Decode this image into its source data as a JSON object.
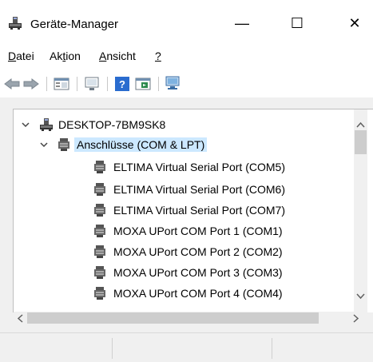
{
  "window": {
    "title": "Geräte-Manager",
    "controls": {
      "minimize": "—",
      "maximize": "☐",
      "close": "✕"
    }
  },
  "menu": [
    {
      "pre": "",
      "u": "D",
      "post": "atei"
    },
    {
      "pre": "Ak",
      "u": "t",
      "post": "ion"
    },
    {
      "pre": "",
      "u": "A",
      "post": "nsicht"
    },
    {
      "pre": "",
      "u": "?",
      "post": ""
    }
  ],
  "toolbar": {
    "icons": [
      "back-icon",
      "forward-icon",
      "properties-icon",
      "monitor-icon",
      "help-icon",
      "driver-icon",
      "scan-hardware-icon"
    ]
  },
  "tree": {
    "root": "DESKTOP-7BM9SK8",
    "category": "Anschlüsse (COM & LPT)",
    "devices": [
      "ELTIMA Virtual Serial Port (COM5)",
      "ELTIMA Virtual Serial Port (COM6)",
      "ELTIMA Virtual Serial Port (COM7)",
      "MOXA UPort COM Port 1 (COM1)",
      "MOXA UPort COM Port 2 (COM2)",
      "MOXA UPort COM Port 3 (COM3)",
      "MOXA UPort COM Port 4 (COM4)"
    ]
  },
  "colors": {
    "selection": "#cce8ff",
    "background": "#ffffff",
    "chrome": "#f0f0f0"
  }
}
